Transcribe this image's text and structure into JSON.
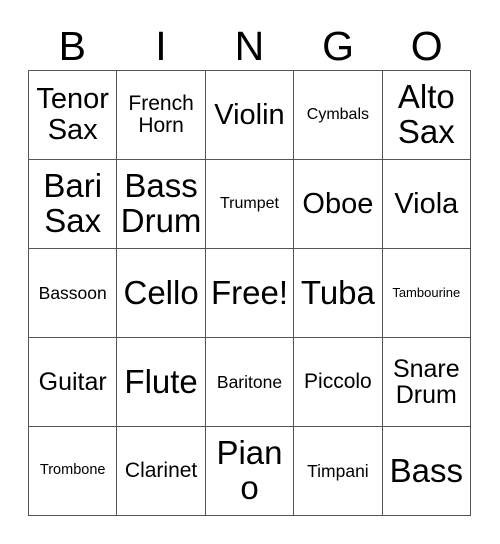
{
  "card": {
    "title": "BINGO",
    "header_letters": [
      "B",
      "I",
      "N",
      "G",
      "O"
    ],
    "border_color": "#555555",
    "text_color": "#000000",
    "background_color": "#ffffff",
    "columns": 5,
    "rows": 5,
    "cells": [
      {
        "text": "Tenor\nSax",
        "size": "xl",
        "free": false
      },
      {
        "text": "French\nHorn",
        "size": "ml",
        "free": false
      },
      {
        "text": "Violin",
        "size": "xl",
        "free": false
      },
      {
        "text": "Cymbals",
        "size": "sm",
        "free": false
      },
      {
        "text": "Alto\nSax",
        "size": "xxl",
        "free": false
      },
      {
        "text": "Bari\nSax",
        "size": "xxl",
        "free": false
      },
      {
        "text": "Bass\nDrum",
        "size": "xxl",
        "free": false
      },
      {
        "text": "Trumpet",
        "size": "sm",
        "free": false
      },
      {
        "text": "Oboe",
        "size": "xl",
        "free": false
      },
      {
        "text": "Viola",
        "size": "xl",
        "free": false
      },
      {
        "text": "Bassoon",
        "size": "m",
        "free": false
      },
      {
        "text": "Cello",
        "size": "xxl",
        "free": false
      },
      {
        "text": "Free!",
        "size": "xxl",
        "free": true
      },
      {
        "text": "Tuba",
        "size": "xxl",
        "free": false
      },
      {
        "text": "Tambourine",
        "size": "xs",
        "free": false
      },
      {
        "text": "Guitar",
        "size": "l",
        "free": false
      },
      {
        "text": "Flute",
        "size": "xxl",
        "free": false
      },
      {
        "text": "Baritone",
        "size": "m",
        "free": false
      },
      {
        "text": "Piccolo",
        "size": "ml",
        "free": false
      },
      {
        "text": "Snare\nDrum",
        "size": "l",
        "free": false
      },
      {
        "text": "Trombone",
        "size": "s",
        "free": false
      },
      {
        "text": "Clarinet",
        "size": "ml",
        "free": false
      },
      {
        "text": "Piano",
        "size": "xxl",
        "free": false
      },
      {
        "text": "Timpani",
        "size": "m",
        "free": false
      },
      {
        "text": "Bass",
        "size": "xxl",
        "free": false
      }
    ]
  }
}
